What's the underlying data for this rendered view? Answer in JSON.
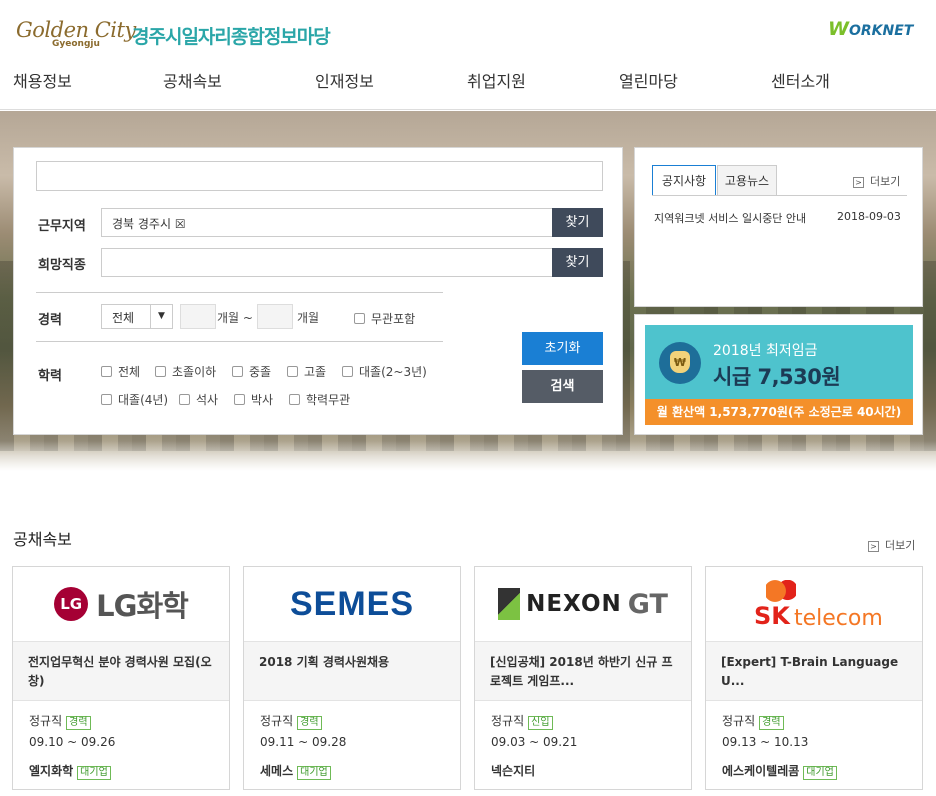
{
  "header": {
    "logo_text": "Golden City",
    "logo_sub": "Gyeongju",
    "site_title": "경주시일자리종합정보마당",
    "worknet_w": "W",
    "worknet_rest": "ORKNET"
  },
  "nav": {
    "items": [
      {
        "label": "채용정보"
      },
      {
        "label": "공채속보"
      },
      {
        "label": "인재정보"
      },
      {
        "label": "취업지원"
      },
      {
        "label": "열린마당"
      },
      {
        "label": "센터소개"
      }
    ]
  },
  "search": {
    "keyword_value": "",
    "region_label": "근무지역",
    "region_value": "경북 경주시 ☒",
    "job_label": "희망직종",
    "job_value": "",
    "find_label": "찾기",
    "career_label": "경력",
    "career_select": "전체",
    "career_from_unit": "개월 ~",
    "career_to_unit": "개월",
    "career_any": "무관포함",
    "edu_label": "학력",
    "edu_options": [
      "전체",
      "초졸이하",
      "중졸",
      "고졸",
      "대졸(2~3년)",
      "대졸(4년)",
      "석사",
      "박사",
      "학력무관"
    ],
    "reset_label": "초기화",
    "search_label": "검색"
  },
  "notice": {
    "tabs": [
      "공지사항",
      "고용뉴스"
    ],
    "more_label": "더보기",
    "items": [
      {
        "title": "지역워크넷 서비스 일시중단 안내",
        "date": "2018-09-03"
      }
    ]
  },
  "wage": {
    "icon_letter": "₩",
    "line1": "2018년 최저임금",
    "line2": "시급 7,530원",
    "monthly": "월 환산액 1,573,770원(주 소정근로 40시간)"
  },
  "recruit": {
    "section_title": "공채속보",
    "more_label": "더보기",
    "cards": [
      {
        "logo": "LG화학",
        "logo_mark": "LG",
        "title": "전지업무혁신 분야 경력사원 모집(오창)",
        "type": "정규직",
        "badge": "경력",
        "period": "09.10 ~ 09.26",
        "company": "엘지화학",
        "company_badge": "대기업"
      },
      {
        "logo": "SEMES",
        "title": "2018 기획 경력사원채용",
        "type": "정규직",
        "badge": "경력",
        "period": "09.11 ~ 09.28",
        "company": "세메스",
        "company_badge": "대기업"
      },
      {
        "logo": "NEXON",
        "logo_suffix": "GT",
        "title": "[신입공채] 2018년 하반기 신규 프로젝트 게임프...",
        "type": "정규직",
        "badge": "신입",
        "period": "09.03 ~ 09.21",
        "company": "넥슨지티",
        "company_badge": ""
      },
      {
        "logo": "SK",
        "logo_suffix": "telecom",
        "title": "[Expert] T-Brain Language U...",
        "type": "정규직",
        "badge": "경력",
        "period": "09.13 ~ 10.13",
        "company": "에스케이텔레콤",
        "company_badge": "대기업"
      }
    ]
  }
}
